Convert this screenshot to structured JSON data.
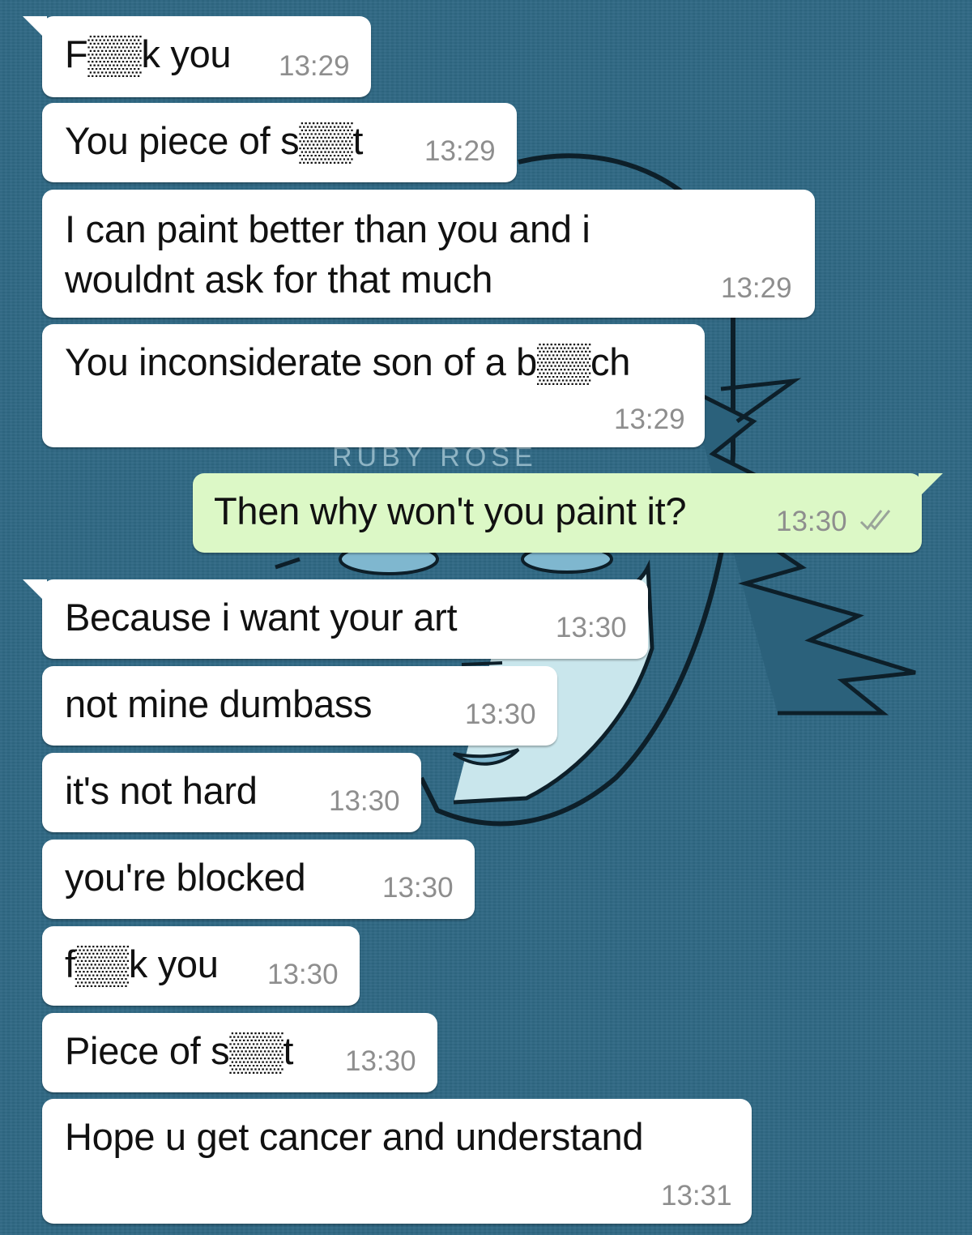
{
  "chat": {
    "messages": [
      {
        "direction": "in",
        "text": "F▒▒k you",
        "time": "13:29"
      },
      {
        "direction": "in",
        "text": "You piece of s▒▒t",
        "time": "13:29"
      },
      {
        "direction": "in",
        "text": [
          "I can paint better than you and i",
          "wouldnt ask for that much"
        ],
        "time": "13:29"
      },
      {
        "direction": "in",
        "text": "You inconsiderate son of a b▒▒ch",
        "time": "13:29"
      },
      {
        "direction": "out",
        "text": "Then why won't you paint it?",
        "time": "13:30",
        "status_icon": "double-check-icon"
      },
      {
        "direction": "in",
        "text": "Because i want your art",
        "time": "13:30"
      },
      {
        "direction": "in",
        "text": "not mine dumbass",
        "time": "13:30"
      },
      {
        "direction": "in",
        "text": "it's not hard",
        "time": "13:30"
      },
      {
        "direction": "in",
        "text": "you're blocked",
        "time": "13:30"
      },
      {
        "direction": "in",
        "text": "f▒▒k you",
        "time": "13:30"
      },
      {
        "direction": "in",
        "text": "Piece of s▒▒t",
        "time": "13:30"
      },
      {
        "direction": "in",
        "text": "Hope u get cancer and understand",
        "time": "13:31"
      }
    ]
  },
  "colors": {
    "wallpaper": "#2f6884",
    "incoming_bubble": "#ffffff",
    "outgoing_bubble": "#dcf8c6",
    "timestamp": "#8e8e8e"
  },
  "wallpaper": {
    "watermark": "RUBY ROSE"
  }
}
